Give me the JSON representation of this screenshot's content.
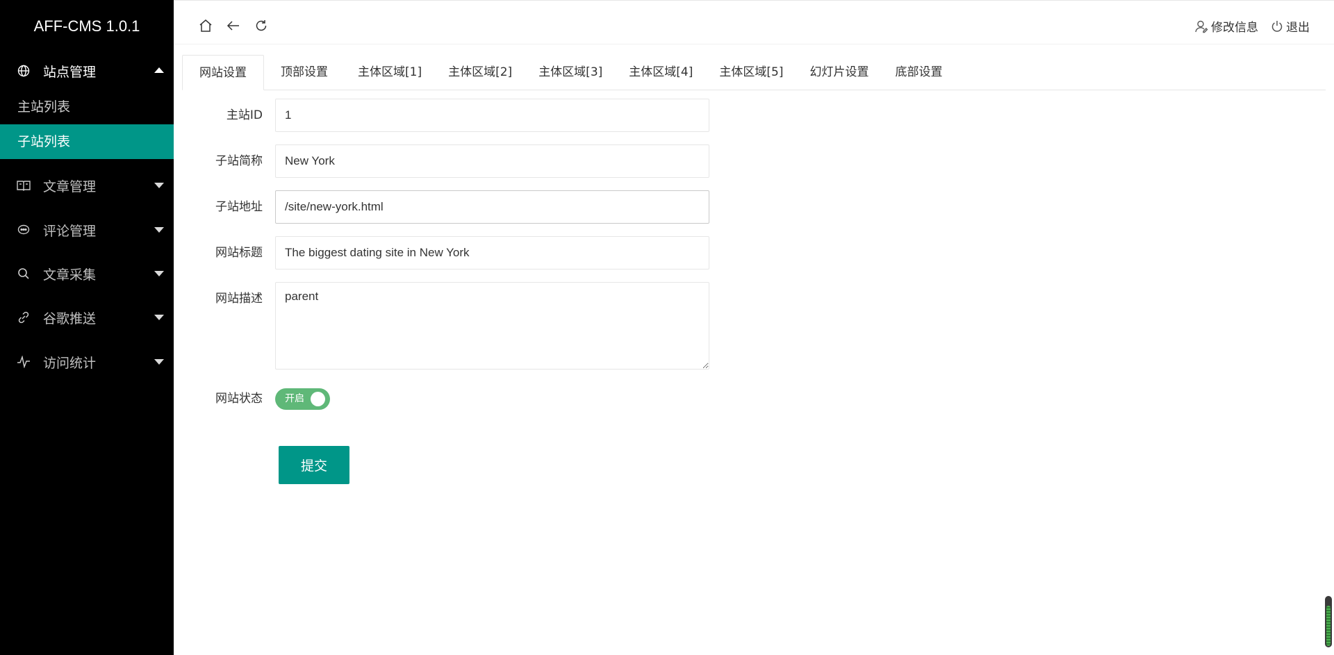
{
  "app": {
    "title": "AFF-CMS 1.0.1"
  },
  "sidebar": {
    "groups": [
      {
        "label": "站点管理",
        "icon": "globe-icon",
        "open": true,
        "items": [
          {
            "label": "主站列表",
            "active": false
          },
          {
            "label": "子站列表",
            "active": true
          }
        ]
      },
      {
        "label": "文章管理",
        "icon": "book-icon",
        "open": false
      },
      {
        "label": "评论管理",
        "icon": "comment-icon",
        "open": false
      },
      {
        "label": "文章采集",
        "icon": "search-icon",
        "open": false
      },
      {
        "label": "谷歌推送",
        "icon": "link-icon",
        "open": false
      },
      {
        "label": "访问统计",
        "icon": "pulse-icon",
        "open": false
      }
    ]
  },
  "header": {
    "home_icon": "home-icon",
    "back_icon": "back-arrow-icon",
    "refresh_icon": "refresh-icon",
    "edit_profile_label": "修改信息",
    "logout_label": "退出"
  },
  "tabs": [
    {
      "label": "网站设置",
      "active": true
    },
    {
      "label": "顶部设置",
      "active": false
    },
    {
      "label": "主体区域[1]",
      "active": false
    },
    {
      "label": "主体区域[2]",
      "active": false
    },
    {
      "label": "主体区域[3]",
      "active": false
    },
    {
      "label": "主体区域[4]",
      "active": false
    },
    {
      "label": "主体区域[5]",
      "active": false
    },
    {
      "label": "幻灯片设置",
      "active": false
    },
    {
      "label": "底部设置",
      "active": false
    }
  ],
  "form": {
    "site_id": {
      "label": "主站ID",
      "value": "1"
    },
    "short_name": {
      "label": "子站简称",
      "value": "New York"
    },
    "address": {
      "label": "子站地址",
      "value": "/site/new-york.html"
    },
    "title": {
      "label": "网站标题",
      "value": "The biggest dating site in New York"
    },
    "description": {
      "label": "网站描述",
      "value": "parent"
    },
    "status": {
      "label": "网站状态",
      "switch_text": "开启",
      "on": true
    },
    "submit_label": "提交"
  },
  "colors": {
    "sidebar_bg": "#000000",
    "accent": "#009688",
    "switch_on": "#5FB878"
  }
}
